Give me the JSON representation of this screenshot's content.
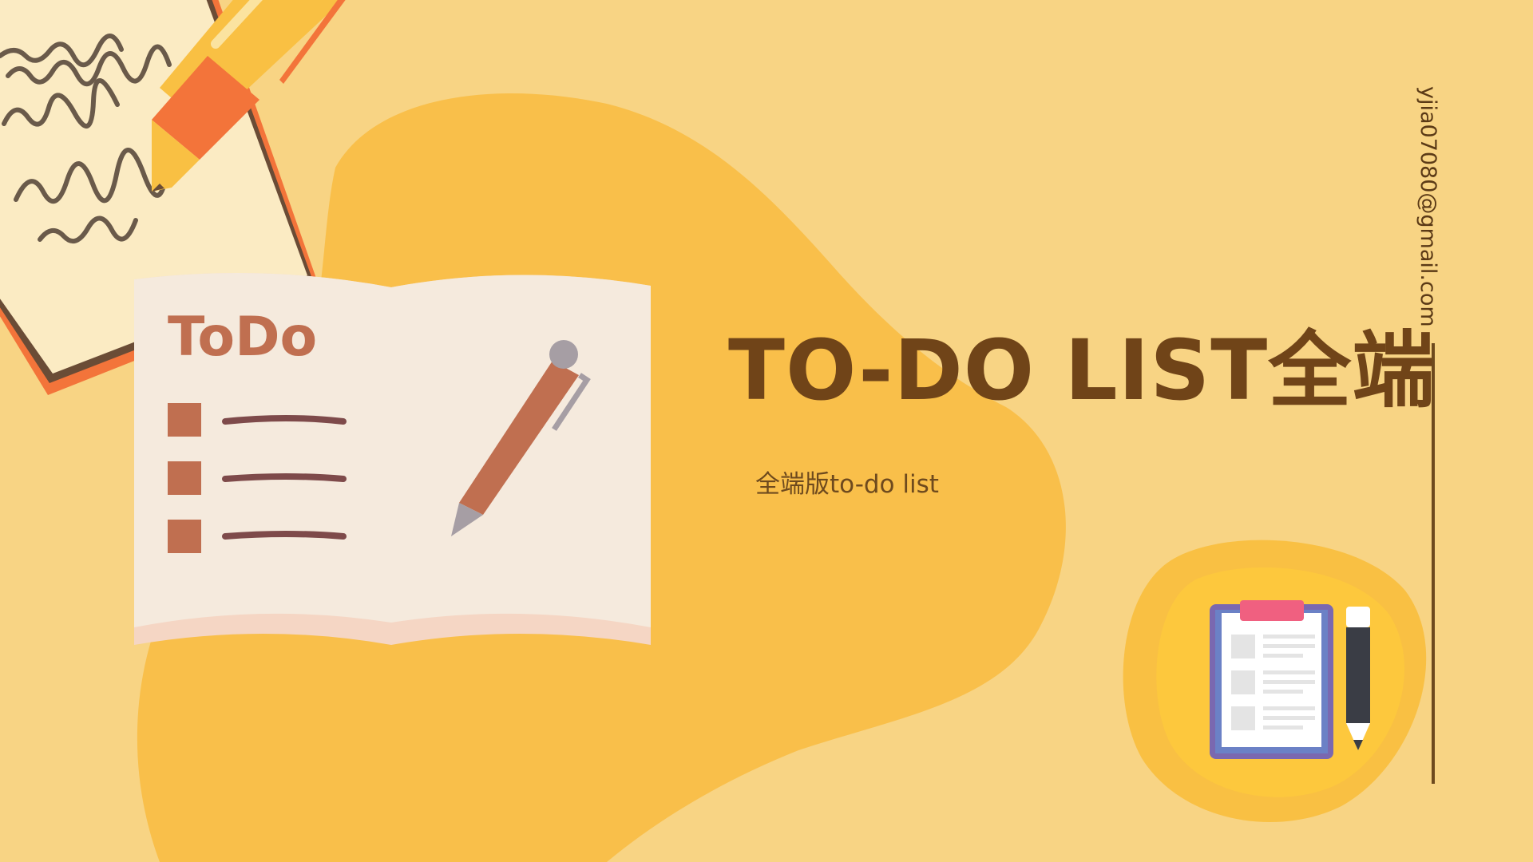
{
  "slide": {
    "title": "TO-DO LIST全端",
    "subtitle": "全端版to-do list",
    "email": "yjia07080@gmail.com",
    "notebook_label": "ToDo"
  },
  "icons": [
    "handwritten-note-icon",
    "orange-pen-icon",
    "todo-notebook-icon",
    "clipboard-icon",
    "pencil-icon"
  ],
  "colors": {
    "background": "#F8D484",
    "blob": "#F9BF4A",
    "title_text": "#704418",
    "accent_brown": "#C06F50",
    "notebook_page": "#F5EADD",
    "clipboard_frame": "#7A68B0",
    "clipboard_clip": "#F06080"
  }
}
